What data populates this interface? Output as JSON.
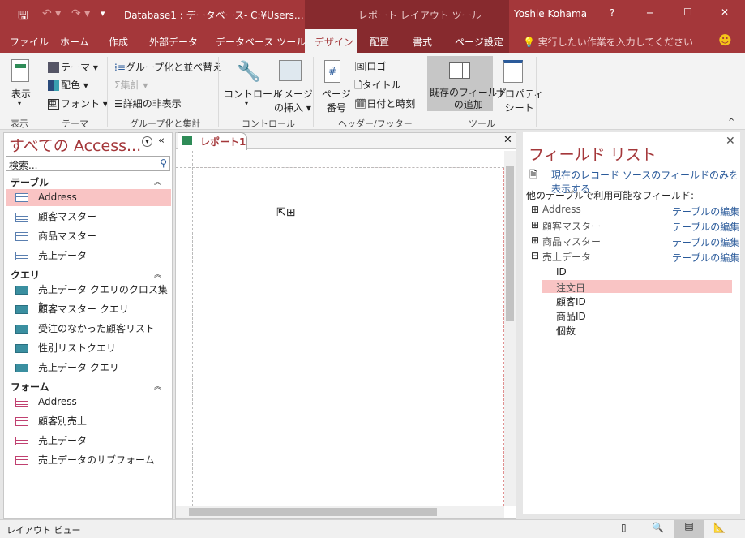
{
  "titlebar": {
    "title": "Database1 : データベース- C:¥Users…",
    "context_tab": "レポート レイアウト ツール",
    "user": "Yoshie Kohama",
    "help": "?",
    "minimize": "─",
    "maximize": "☐",
    "close": "✕"
  },
  "tabs": [
    "ファイル",
    "ホーム",
    "作成",
    "外部データ",
    "データベース ツール",
    "デザイン",
    "配置",
    "書式",
    "ページ設定"
  ],
  "tell_me": "実行したい作業を入力してください",
  "ribbon": {
    "view": "表示",
    "theme": "テーマ",
    "colors": "配色",
    "fonts": "フォント",
    "group_sort": "グループ化と並べ替え",
    "totals": "集計",
    "hide_details": "詳細の非表示",
    "controls": "コントロール",
    "insert_image_1": "イメージ",
    "insert_image_2": "の挿入",
    "page_num_1": "ページ",
    "page_num_2": "番号",
    "logo": "ロゴ",
    "title": "タイトル",
    "date_time": "日付と時刻",
    "add_fields_1": "既存のフィールド",
    "add_fields_2": "の追加",
    "prop_1": "プロパティ",
    "prop_2": "シート",
    "groups": [
      "表示",
      "テーマ",
      "グループ化と集計",
      "コントロール",
      "ヘッダー/フッター",
      "ツール"
    ]
  },
  "nav": {
    "title": "すべての Access...",
    "search_placeholder": "検索...",
    "groups": [
      {
        "label": "テーブル",
        "items": [
          "Address",
          "顧客マスター",
          "商品マスター",
          "売上データ"
        ]
      },
      {
        "label": "クエリ",
        "items": [
          "売上データ クエリのクロス集計",
          "顧客マスター クエリ",
          "受注のなかった顧客リスト",
          "性別リストクエリ",
          "売上データ クエリ"
        ]
      },
      {
        "label": "フォーム",
        "items": [
          "Address",
          "顧客別売上",
          "売上データ",
          "売上データのサブフォーム"
        ]
      }
    ],
    "selected": "Address"
  },
  "doc": {
    "tab": "レポート1"
  },
  "field_list": {
    "title": "フィールド リスト",
    "show_only": "現在のレコード ソースのフィールドのみを表示する",
    "other_label": "他のテーブルで利用可能なフィールド:",
    "tables": [
      {
        "name": "Address",
        "edit": "テーブルの編集",
        "expanded": false
      },
      {
        "name": "顧客マスター",
        "edit": "テーブルの編集",
        "expanded": false
      },
      {
        "name": "商品マスター",
        "edit": "テーブルの編集",
        "expanded": false
      },
      {
        "name": "売上データ",
        "edit": "テーブルの編集",
        "expanded": true
      }
    ],
    "fields": [
      "ID",
      "注文日",
      "顧客ID",
      "商品ID",
      "個数"
    ],
    "selected_field": "注文日"
  },
  "status": {
    "view": "レイアウト ビュー"
  },
  "colors": {
    "accent": "#a4373a",
    "selection": "#f9c4c4"
  }
}
